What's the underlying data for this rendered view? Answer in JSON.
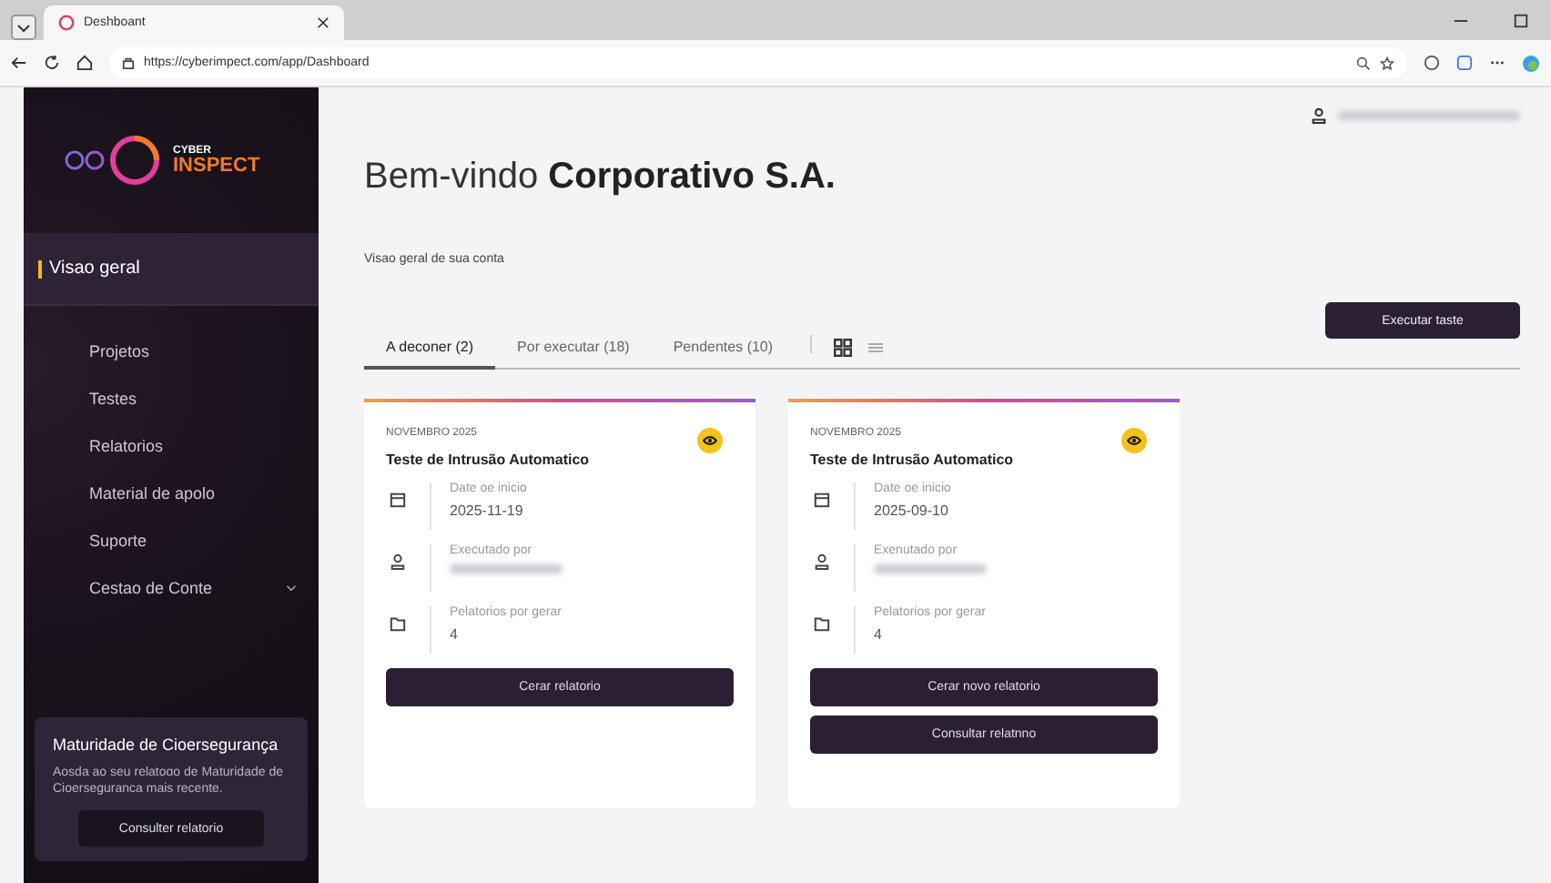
{
  "browser": {
    "tab_title": "Deshboant",
    "url": "https://cyberimpect.com/app/Dashboard"
  },
  "sidebar": {
    "logo": {
      "top": "CYBER",
      "bottom": "INSPECT"
    },
    "items": [
      {
        "label": "Visao geral",
        "selected": true
      },
      {
        "label": "Projetos",
        "selected": false
      },
      {
        "label": "Testes",
        "selected": false
      },
      {
        "label": "Relatorios",
        "selected": false
      },
      {
        "label": "Material de apolo",
        "selected": false
      },
      {
        "label": "Suporte",
        "selected": false
      },
      {
        "label": "Cestao de Conte",
        "selected": false,
        "expandable": true
      }
    ],
    "promo": {
      "title": "Maturidade de Cioerseguranҫa",
      "text": "Aosda ao seu relatoɑo de Maturidade de Cioerseguranca mais recente.",
      "button": "Consulter relatorio"
    }
  },
  "header": {
    "greeting": "Bem-vindo",
    "company": "Corporativo S.A.",
    "subtitle": "Visao geral de sua conta"
  },
  "tabs": [
    {
      "label": "A deconer (2)",
      "selected": true
    },
    {
      "label": "Por executar (18)",
      "selected": false
    },
    {
      "label": "Pendentes (10)",
      "selected": false
    }
  ],
  "view_toggle": {
    "grid_selected": true
  },
  "action_button": "Executar taste",
  "cards": [
    {
      "month": "NOVEMBRO 2025",
      "title": "Teste de Intrusão Automatico",
      "fields": [
        {
          "kind": "date",
          "label": "Date oe inicio",
          "value": "2025-11-19"
        },
        {
          "kind": "person",
          "label": "Executado por"
        },
        {
          "kind": "folder",
          "label": "Pelatorios por gerar",
          "value": "4"
        }
      ],
      "buttons": [
        "Cerar relatorio"
      ]
    },
    {
      "month": "NOVEMBRO 2025",
      "title": "Teste de Intrusão Automatico",
      "fields": [
        {
          "kind": "date",
          "label": "Date oe inicio",
          "value": "2025-09-10"
        },
        {
          "kind": "person",
          "label": "Exenutado por"
        },
        {
          "kind": "folder",
          "label": "Pelatorios por gerar",
          "value": "4"
        }
      ],
      "buttons": [
        "Cerar novo relatorio",
        "Consultar relatnno"
      ]
    }
  ]
}
